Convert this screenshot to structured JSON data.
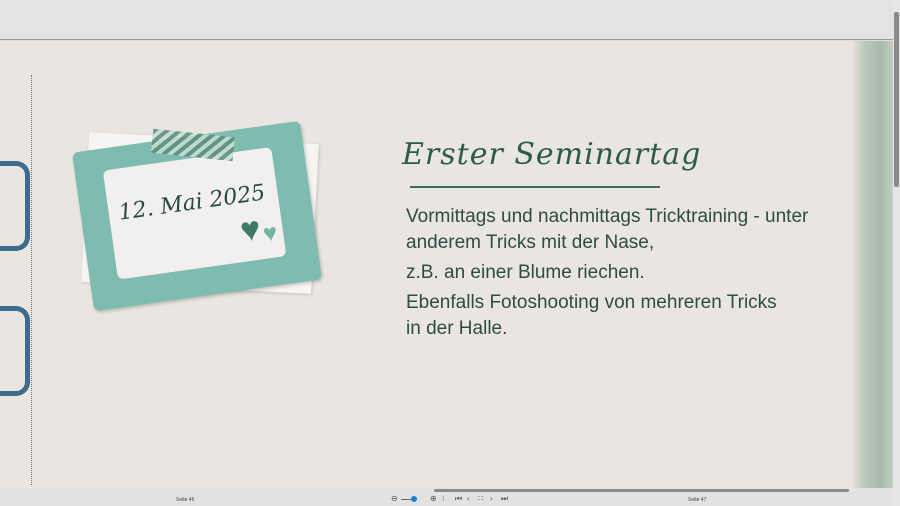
{
  "slide": {
    "date": "12. Mai 2025",
    "title": "Erster Seminartag",
    "paragraphs": [
      "Vormittags und nachmittags Tricktraining - unter anderem Tricks mit der Nase,",
      "z.B. an einer Blume riechen.",
      "Ebenfalls Fotoshooting von mehreren Tricks in der Halle."
    ]
  },
  "status": {
    "left_page": "Seite 46",
    "right_page": "Seite 47"
  },
  "colors": {
    "accent": "#2d5b4a",
    "frame": "#7fbcb0",
    "zoom_knob": "#1a7fd6"
  }
}
